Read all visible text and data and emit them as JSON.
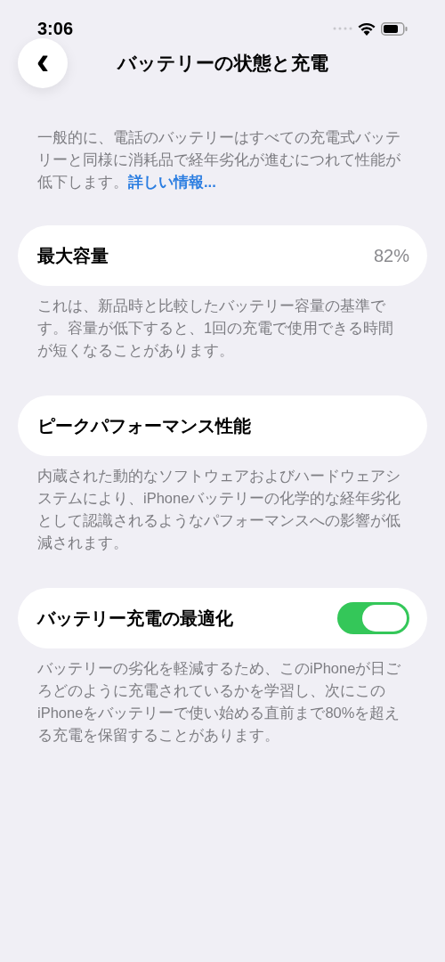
{
  "status_bar": {
    "time": "3:06"
  },
  "nav": {
    "back": "‹",
    "title": "バッテリーの状態と充電"
  },
  "intro": {
    "text": "一般的に、電話のバッテリーはすべての充電式バッテリーと同様に消耗品で経年劣化が進むにつれて性能が低下します。",
    "link": "詳しい情報..."
  },
  "sections": [
    {
      "kind": "value",
      "label": "最大容量",
      "value": "82%",
      "footer": "これは、新品時と比較したバッテリー容量の基準です。容量が低下すると、1回の充電で使用できる時間が短くなることがあります。"
    },
    {
      "kind": "plain",
      "label": "ピークパフォーマンス性能",
      "footer": "内蔵された動的なソフトウェアおよびハードウェアシステムにより、iPhoneバッテリーの化学的な経年劣化として認識されるようなパフォーマンスへの影響が低減されます。"
    },
    {
      "kind": "toggle",
      "label": "バッテリー充電の最適化",
      "on": true,
      "footer": "バッテリーの劣化を軽減するため、このiPhoneが日ごろどのように充電されているかを学習し、次にこのiPhoneをバッテリーで使い始める直前まで80%を超える充電を保留することがあります。"
    }
  ]
}
